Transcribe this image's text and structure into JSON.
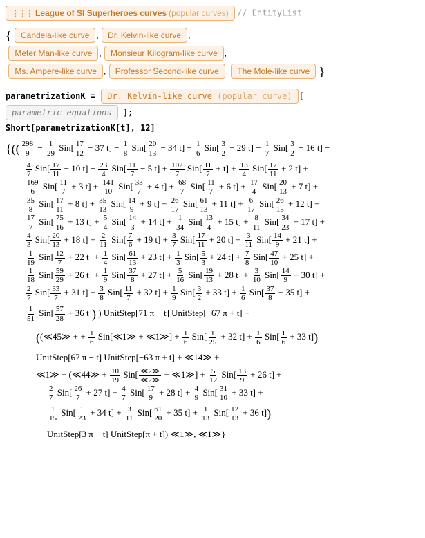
{
  "header": {
    "entityClassName": "League of SI Superheroes curves",
    "entityClassSub": "(popular curves)",
    "comment": "// EntityList"
  },
  "entities": [
    "Candela-like curve",
    "Dr. Kelvin-like curve",
    "Meter Man-like curve",
    "Monsieur Kilogram-like curve",
    "Ms. Ampere-like curve",
    "Professor Second-like curve",
    "The Mole-like curve"
  ],
  "assign": {
    "lhs": "parametrizationK =",
    "entityName": "Dr. Kelvin-like curve",
    "entitySub": "(popular curve)",
    "propName": "parametric equations",
    "tail": ";"
  },
  "shortCall": "Short[parametrizationK[t], 12]",
  "math": {
    "open": "{((",
    "line0_lead": {
      "a": "298",
      "b": "9"
    },
    "terms0": [
      {
        "sign": "−",
        "c": [
          "1",
          "29"
        ],
        "arg": [
          [
            "17",
            "12"
          ],
          "− 37 t"
        ]
      },
      {
        "sign": "−",
        "c": [
          "1",
          "8"
        ],
        "arg": [
          [
            "20",
            "13"
          ],
          "− 34 t"
        ]
      },
      {
        "sign": "−",
        "c": [
          "1",
          "6"
        ],
        "arg": [
          [
            "3",
            "2"
          ],
          "− 29 t"
        ]
      },
      {
        "sign": "−",
        "c": [
          "1",
          "7"
        ],
        "arg": [
          [
            "3",
            "2"
          ],
          "− 16 t"
        ]
      }
    ],
    "terms1": [
      {
        "sign": "−",
        "c": [
          "4",
          "7"
        ],
        "arg": [
          [
            "17",
            "11"
          ],
          "− 10 t"
        ]
      },
      {
        "sign": "−",
        "c": [
          "23",
          "4"
        ],
        "arg": [
          [
            "11",
            "7"
          ],
          "− 5 t"
        ]
      },
      {
        "sign": "+",
        "c": [
          "102",
          "7"
        ],
        "arg": [
          [
            "11",
            "7"
          ],
          "+ t"
        ]
      },
      {
        "sign": "+",
        "c": [
          "13",
          "4"
        ],
        "arg": [
          [
            "17",
            "11"
          ],
          "+ 2 t"
        ]
      }
    ],
    "terms2": [
      {
        "sign": "+",
        "c": [
          "169",
          "6"
        ],
        "arg": [
          [
            "11",
            "7"
          ],
          "+ 3 t"
        ]
      },
      {
        "sign": "+",
        "c": [
          "141",
          "10"
        ],
        "arg": [
          [
            "33",
            "7"
          ],
          "+ 4 t"
        ]
      },
      {
        "sign": "+",
        "c": [
          "68",
          "7"
        ],
        "arg": [
          [
            "11",
            "7"
          ],
          "+ 6 t"
        ]
      },
      {
        "sign": "+",
        "c": [
          "17",
          "4"
        ],
        "arg": [
          [
            "20",
            "13"
          ],
          "+ 7 t"
        ]
      }
    ],
    "terms3": [
      {
        "sign": "+",
        "c": [
          "35",
          "8"
        ],
        "arg": [
          [
            "17",
            "11"
          ],
          "+ 8 t"
        ]
      },
      {
        "sign": "+",
        "c": [
          "35",
          "13"
        ],
        "arg": [
          [
            "14",
            "9"
          ],
          "+ 9 t"
        ]
      },
      {
        "sign": "+",
        "c": [
          "26",
          "17"
        ],
        "arg": [
          [
            "61",
            "13"
          ],
          "+ 11 t"
        ]
      },
      {
        "sign": "+",
        "c": [
          "6",
          "17"
        ],
        "arg": [
          [
            "26",
            "15"
          ],
          "+ 12 t"
        ]
      }
    ],
    "terms4": [
      {
        "sign": "+",
        "c": [
          "17",
          "7"
        ],
        "arg": [
          [
            "75",
            "16"
          ],
          "+ 13 t"
        ]
      },
      {
        "sign": "+",
        "c": [
          "5",
          "4"
        ],
        "arg": [
          [
            "14",
            "3"
          ],
          "+ 14 t"
        ]
      },
      {
        "sign": "+",
        "c": [
          "1",
          "34"
        ],
        "arg": [
          [
            "13",
            "4"
          ],
          "+ 15 t"
        ]
      },
      {
        "sign": "+",
        "c": [
          "8",
          "11"
        ],
        "arg": [
          [
            "34",
            "23"
          ],
          "+ 17 t"
        ]
      }
    ],
    "terms5": [
      {
        "sign": "+",
        "c": [
          "4",
          "3"
        ],
        "arg": [
          [
            "20",
            "13"
          ],
          "+ 18 t"
        ]
      },
      {
        "sign": "+",
        "c": [
          "2",
          "11"
        ],
        "arg": [
          [
            "7",
            "6"
          ],
          "+ 19 t"
        ]
      },
      {
        "sign": "+",
        "c": [
          "3",
          "7"
        ],
        "arg": [
          [
            "17",
            "11"
          ],
          "+ 20 t"
        ]
      },
      {
        "sign": "+",
        "c": [
          "3",
          "11"
        ],
        "arg": [
          [
            "14",
            "9"
          ],
          "+ 21 t"
        ]
      }
    ],
    "terms6": [
      {
        "sign": "+",
        "c": [
          "1",
          "19"
        ],
        "arg": [
          [
            "12",
            "7"
          ],
          "+ 22 t"
        ]
      },
      {
        "sign": "+",
        "c": [
          "1",
          "4"
        ],
        "arg": [
          [
            "61",
            "13"
          ],
          "+ 23 t"
        ]
      },
      {
        "sign": "+",
        "c": [
          "1",
          "3"
        ],
        "arg": [
          [
            "5",
            "3"
          ],
          "+ 24 t"
        ]
      },
      {
        "sign": "+",
        "c": [
          "7",
          "8"
        ],
        "arg": [
          [
            "47",
            "10"
          ],
          "+ 25 t"
        ]
      }
    ],
    "terms7": [
      {
        "sign": "+",
        "c": [
          "1",
          "18"
        ],
        "arg": [
          [
            "59",
            "29"
          ],
          "+ 26 t"
        ]
      },
      {
        "sign": "+",
        "c": [
          "1",
          "9"
        ],
        "arg": [
          [
            "37",
            "8"
          ],
          "+ 27 t"
        ]
      },
      {
        "sign": "+",
        "c": [
          "5",
          "16"
        ],
        "arg": [
          [
            "19",
            "13"
          ],
          "+ 28 t"
        ]
      },
      {
        "sign": "+",
        "c": [
          "3",
          "10"
        ],
        "arg": [
          [
            "14",
            "9"
          ],
          "+ 30 t"
        ]
      }
    ],
    "terms8": [
      {
        "sign": "+",
        "c": [
          "2",
          "7"
        ],
        "arg": [
          [
            "33",
            "7"
          ],
          "+ 31 t"
        ]
      },
      {
        "sign": "+",
        "c": [
          "3",
          "8"
        ],
        "arg": [
          [
            "11",
            "7"
          ],
          "+ 32 t"
        ]
      },
      {
        "sign": "+",
        "c": [
          "1",
          "9"
        ],
        "arg": [
          [
            "3",
            "2"
          ],
          "+ 33 t"
        ]
      },
      {
        "sign": "+",
        "c": [
          "1",
          "6"
        ],
        "arg": [
          [
            "37",
            "8"
          ],
          "+ 35 t"
        ]
      }
    ],
    "terms9": [
      {
        "sign": "+",
        "c": [
          "1",
          "51"
        ],
        "arg": [
          [
            "57",
            "28"
          ],
          "+ 36 t"
        ]
      }
    ],
    "step1": ") UnitStep[71 π − t] UnitStep[−67 π + t] +",
    "midA_lead": "(≪45≫ +",
    "midA": [
      {
        "c": [
          "1",
          "6"
        ],
        "arg_skel": "≪1≫ + ≪1≫"
      },
      {
        "c": [
          "1",
          "6"
        ],
        "arg": [
          [
            "1",
            "25"
          ],
          "+ 32 t"
        ]
      },
      {
        "c": [
          "1",
          "6"
        ],
        "arg": [
          [
            "1",
            "6"
          ],
          "+ 33 t"
        ]
      }
    ],
    "step2": "UnitStep[67 π − t] UnitStep[−63 π + t] + ≪14≫ +",
    "midB_lead": "≪1≫ + (≪44≫ +",
    "midB_first": {
      "c": [
        "10",
        "19"
      ],
      "frac_arg": [
        "≪2≫",
        "≪2≫"
      ],
      "tail": "+ ≪1≫"
    },
    "midB": [
      {
        "sign": "+",
        "c": [
          "5",
          "12"
        ],
        "arg": [
          [
            "13",
            "9"
          ],
          "+ 26 t"
        ]
      }
    ],
    "termsC": [
      {
        "sign": "+",
        "c": [
          "2",
          "7"
        ],
        "arg": [
          [
            "26",
            "7"
          ],
          "+ 27 t"
        ]
      },
      {
        "sign": "+",
        "c": [
          "4",
          "7"
        ],
        "arg": [
          [
            "17",
            "9"
          ],
          "+ 28 t"
        ]
      },
      {
        "sign": "+",
        "c": [
          "4",
          "9"
        ],
        "arg": [
          [
            "31",
            "10"
          ],
          "+ 33 t"
        ]
      }
    ],
    "termsD": [
      {
        "sign": "+",
        "c": [
          "1",
          "15"
        ],
        "arg": [
          [
            "1",
            "23"
          ],
          "+ 34 t"
        ]
      },
      {
        "sign": "+",
        "c": [
          "3",
          "11"
        ],
        "arg": [
          [
            "61",
            "20"
          ],
          "+ 35 t"
        ]
      },
      {
        "sign": "+",
        "c": [
          "1",
          "13"
        ],
        "arg": [
          [
            "12",
            "13"
          ],
          "+ 36 t"
        ]
      }
    ],
    "step3": "UnitStep[3 π − t] UnitStep[π + t]) ≪1≫, ≪1≫}"
  }
}
